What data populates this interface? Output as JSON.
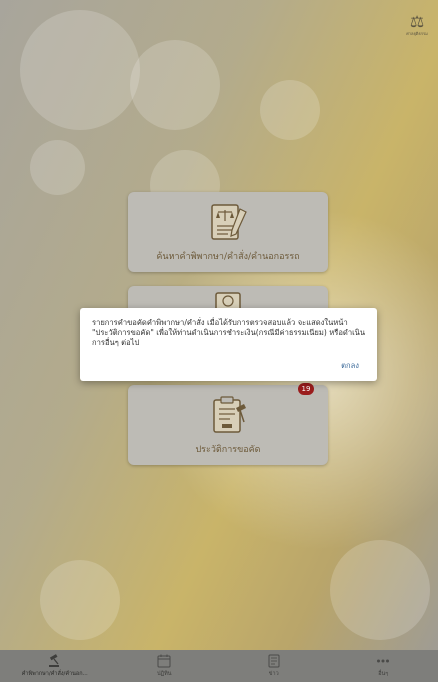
{
  "logo": {
    "mark": "⚖",
    "text": "ศาลยุติธรรม"
  },
  "menu": [
    {
      "label": "ค้นหาคำพิพากษา/คำสั่ง/คำนอกอรรถ",
      "icon": "legal-document-icon"
    },
    {
      "label": "",
      "icon": "document-request-icon"
    },
    {
      "label": "ประวัติการขอคัด",
      "icon": "request-history-icon",
      "badge": "19"
    }
  ],
  "dialog": {
    "message": "รายการคำขอคัดคำพิพากษา/คำสั่ง เมื่อได้รับการตรวจสอบแล้ว จะแสดงในหน้า \"ประวัติการขอคัด\" เพื่อให้ท่านดำเนินการชำระเงิน(กรณีมีค่าธรรมเนียม) หรือดำเนินการอื่นๆ ต่อไป",
    "ok_label": "ตกลง"
  },
  "tabs": [
    {
      "label": "คำพิพากษา/คำสั่ง/คำนอก...",
      "icon": "gavel-icon",
      "active": true
    },
    {
      "label": "ปฏิทิน",
      "icon": "calendar-icon"
    },
    {
      "label": "ข่าว",
      "icon": "news-icon"
    },
    {
      "label": "อื่นๆ",
      "icon": "more-icon"
    }
  ],
  "colors": {
    "card": "#bdbbb5",
    "badge": "#9b1d1d",
    "accent_text": "#6d5a3a",
    "ok": "#3d6b9a"
  }
}
